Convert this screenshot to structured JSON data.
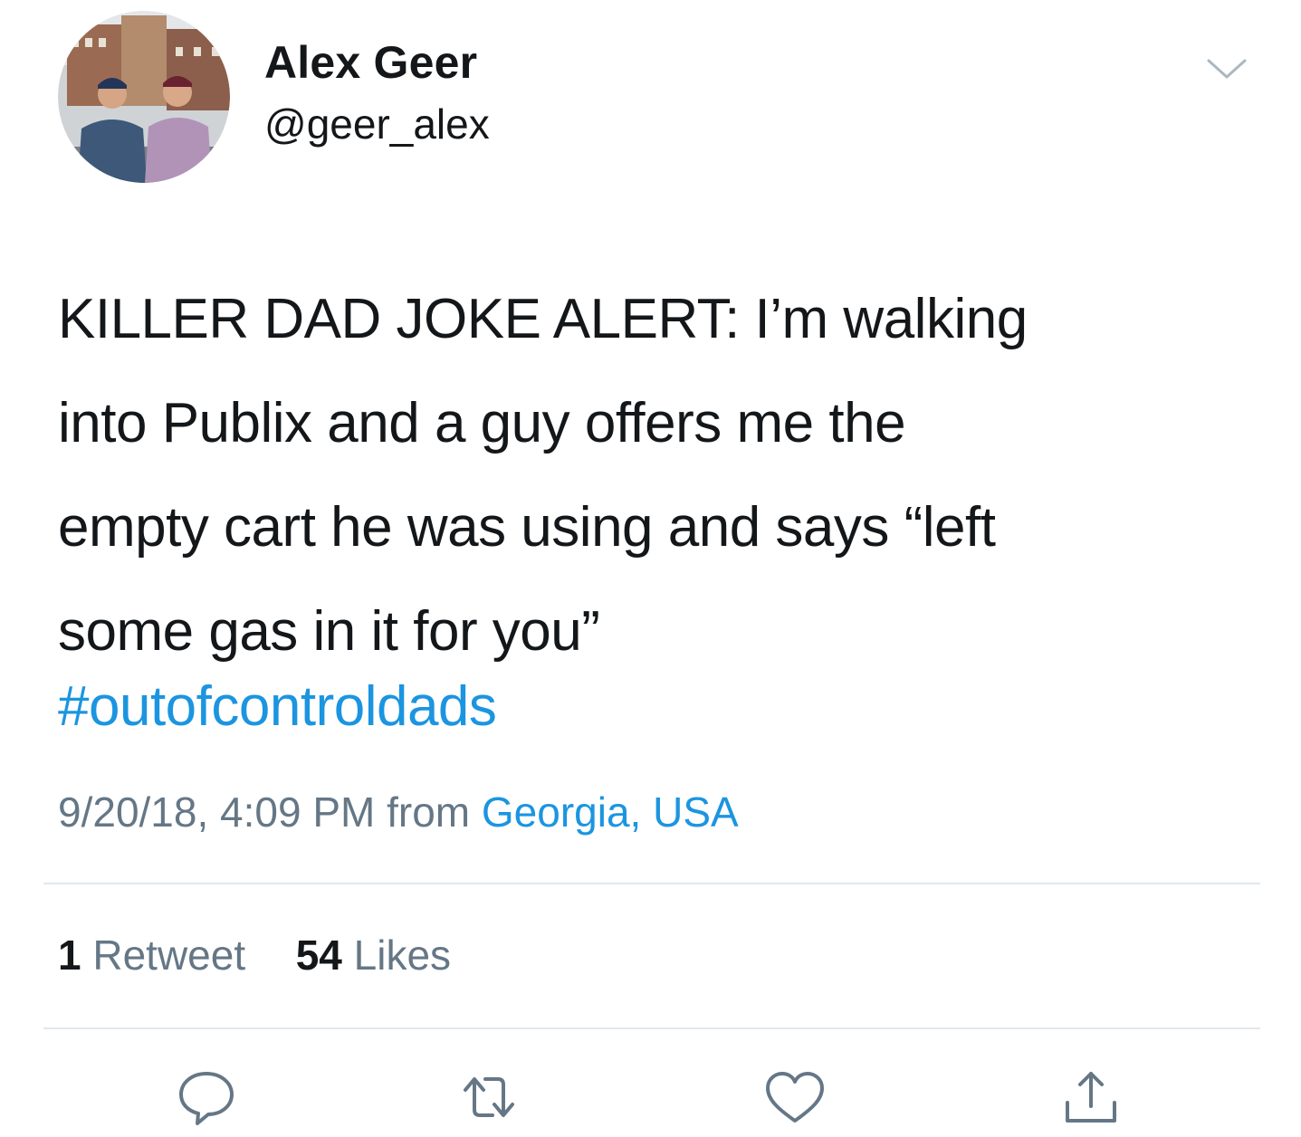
{
  "author": {
    "display_name": "Alex Geer",
    "handle": "@geer_alex"
  },
  "tweet": {
    "text_lines": [
      "KILLER DAD JOKE ALERT: I’m walking",
      "into Publix and a guy offers me the",
      "empty cart he was using and says “left",
      "some gas in it for you”"
    ],
    "hashtag": "#outofcontroldads",
    "timestamp": "9/20/18, 4:09 PM from ",
    "location": "Georgia, USA"
  },
  "stats": {
    "retweet_count": "1",
    "retweet_label": "Retweet",
    "like_count": "54",
    "like_label": "Likes"
  },
  "icons": {
    "more": "chevron-down-icon",
    "reply": "reply-icon",
    "retweet": "retweet-icon",
    "like": "heart-icon",
    "share": "share-icon"
  },
  "colors": {
    "text": "#14171a",
    "secondary": "#657786",
    "link": "#1b95e0",
    "divider": "#e1e8ed"
  }
}
